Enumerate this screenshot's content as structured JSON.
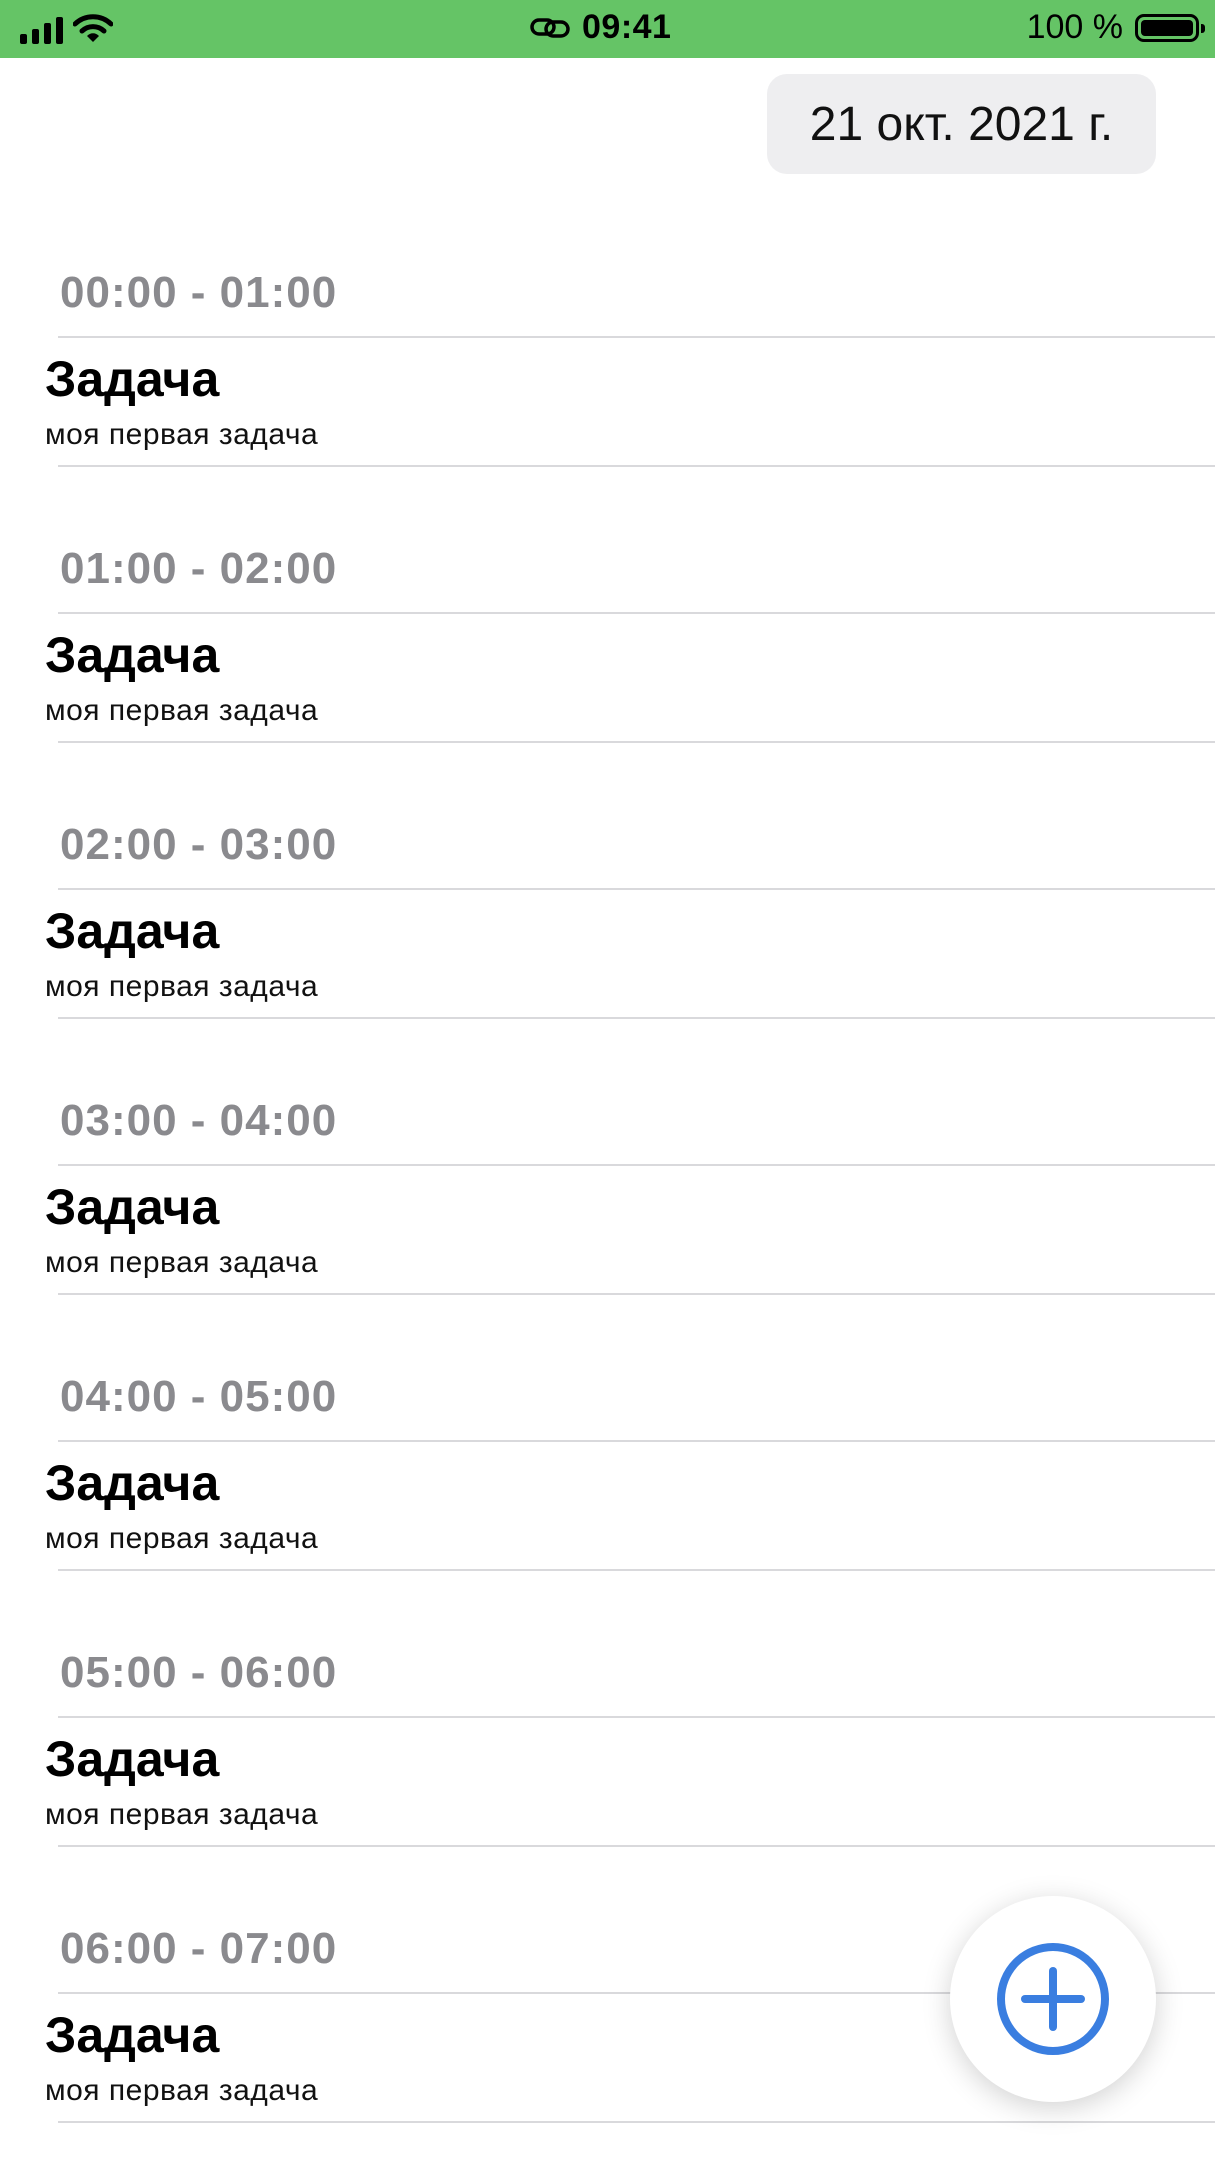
{
  "status_bar": {
    "time": "09:41",
    "battery_text": "100 %",
    "background": "#65c466",
    "icons": [
      "cellular-signal-icon",
      "wifi-icon",
      "link-icon",
      "battery-icon"
    ]
  },
  "header": {
    "date": "21 окт. 2021 г."
  },
  "slots": [
    {
      "time": "00:00 - 01:00",
      "title": "Задача",
      "subtitle": "моя первая задача"
    },
    {
      "time": "01:00 - 02:00",
      "title": "Задача",
      "subtitle": "моя первая задача"
    },
    {
      "time": "02:00 - 03:00",
      "title": "Задача",
      "subtitle": "моя первая задача"
    },
    {
      "time": "03:00 - 04:00",
      "title": "Задача",
      "subtitle": "моя первая задача"
    },
    {
      "time": "04:00 - 05:00",
      "title": "Задача",
      "subtitle": "моя первая задача"
    },
    {
      "time": "05:00 - 06:00",
      "title": "Задача",
      "subtitle": "моя первая задача"
    },
    {
      "time": "06:00 - 07:00",
      "title": "Задача",
      "subtitle": "моя первая задача"
    }
  ],
  "fab": {
    "icon": "plus-circle-icon",
    "accent_color": "#3a7ee0"
  }
}
